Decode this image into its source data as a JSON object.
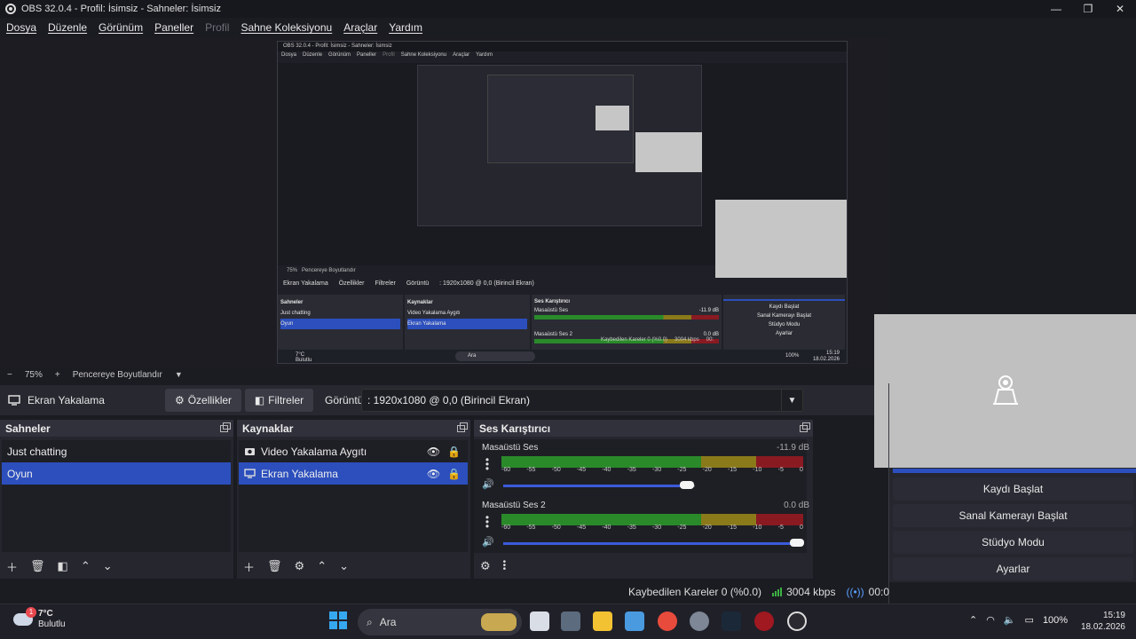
{
  "window": {
    "title": "OBS 32.0.4 - Profil: İsimsiz - Sahneler: İsimsiz",
    "minimize": "—",
    "maximize": "❐",
    "close": "✕"
  },
  "menu": {
    "items": [
      "Dosya",
      "Düzenle",
      "Görünüm",
      "Paneller",
      "Profil",
      "Sahne Koleksiyonu",
      "Araçlar",
      "Yardım"
    ]
  },
  "zoom": {
    "minus": "−",
    "value": "75%",
    "plus": "+",
    "fit_label": "Pencereye Boyutlandır"
  },
  "source_bar": {
    "source_name": "Ekran Yakalama",
    "properties_label": "Özellikler",
    "filters_label": "Filtreler",
    "display_label": "Görüntü",
    "display_value": ": 1920x1080 @ 0,0 (Birincil Ekran)"
  },
  "scenes": {
    "title": "Sahneler",
    "items": [
      "Just chatting",
      "Oyun"
    ],
    "selected": "Oyun"
  },
  "sources": {
    "title": "Kaynaklar",
    "items": [
      {
        "name": "Video Yakalama Aygıtı",
        "icon": "camera-icon"
      },
      {
        "name": "Ekran Yakalama",
        "icon": "monitor-icon"
      }
    ],
    "selected": "Ekran Yakalama"
  },
  "mixer": {
    "title": "Ses Karıştırıcı",
    "ticks": [
      "-60",
      "-55",
      "-50",
      "-45",
      "-40",
      "-35",
      "-30",
      "-25",
      "-20",
      "-15",
      "-10",
      "-5",
      "0"
    ],
    "channels": [
      {
        "name": "Masaüstü Ses",
        "db": "-11.9 dB",
        "volume": 0.92
      },
      {
        "name": "Masaüstü Ses 2",
        "db": "0.0 dB",
        "volume": 1.0
      }
    ]
  },
  "controls": {
    "start_recording": "Kaydı Başlat",
    "virtual_camera": "Sanal Kamerayı Başlat",
    "studio_mode": "Stüdyo Modu",
    "settings": "Ayarlar"
  },
  "status": {
    "dropped_frames": "Kaybedilen Kareler 0 (%0.0)",
    "bitrate": "3004 kbps",
    "timer": "00:0"
  },
  "taskbar": {
    "weather_temp": "7°C",
    "weather_desc": "Bulutlu",
    "weather_badge": "1",
    "search_placeholder": "Ara",
    "battery": "100%",
    "time": "15:19",
    "date": "18.02.2026"
  },
  "nested": {
    "title": "OBS 32.0.4 - Profil: İsimsiz - Sahneler: İsimsiz",
    "menu": [
      "Dosya",
      "Düzenle",
      "Görünüm",
      "Paneller",
      "Profil",
      "Sahne Koleksiyonu",
      "Araçlar",
      "Yardım"
    ],
    "zoom": "75%",
    "fit": "Pencereye Boyutlandır",
    "source": "Ekran Yakalama",
    "props": "Özellikler",
    "filters": "Filtreler",
    "display": "Görüntü",
    "display_value": ": 1920x1080 @ 0,0 (Birincil Ekran)",
    "scenes_title": "Sahneler",
    "scene_items": [
      "Just chatting",
      "Oyun"
    ],
    "sources_title": "Kaynaklar",
    "source_items": [
      "Video Yakalama Aygıtı",
      "Ekran Yakalama"
    ],
    "mixer_title": "Ses Karıştırıcı",
    "ch1": "Masaüstü Ses",
    "ch1_db": "-11.9 dB",
    "ch2": "Masaüstü Ses 2",
    "ch2_db": "0.0 dB",
    "controls": [
      "Kaydı Başlat",
      "Sanal Kamerayı Başlat",
      "Stüdyo Modu",
      "Ayarlar"
    ],
    "status": "Kaybedilen Kareler 0 (%0.0)",
    "bitrate": "3004 kbps",
    "timer": "00:",
    "weather_temp": "7°C",
    "weather_desc": "Bulutlu",
    "search": "Ara",
    "battery": "100%",
    "time": "15:19",
    "date": "18.02.2026"
  }
}
